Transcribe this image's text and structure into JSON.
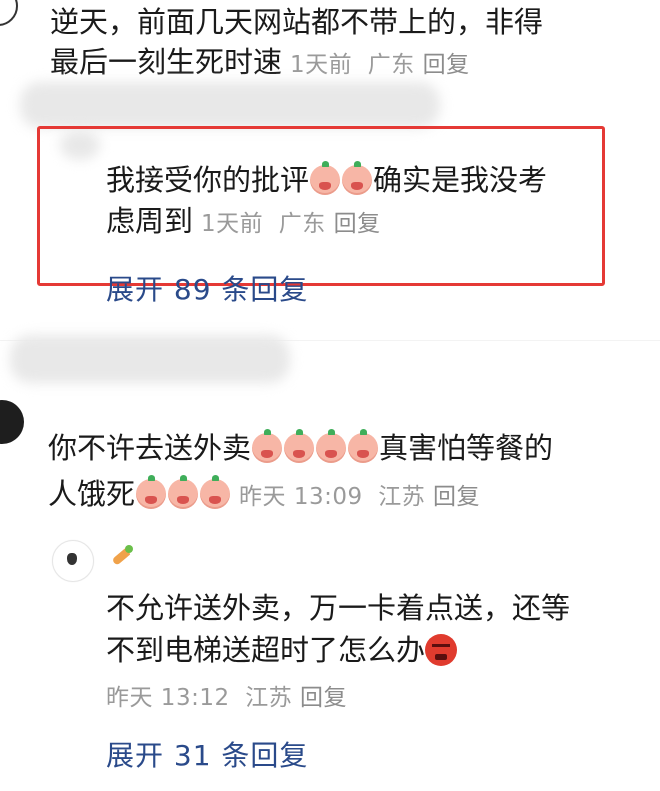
{
  "comment1": {
    "text_line1": "逆天，前面几天网站都不带上的，非得",
    "text_line2": "最后一刻生死时速",
    "time": "1天前",
    "location": "广东",
    "reply_label": "回复"
  },
  "reply1": {
    "text_line1_part1": "我接受你的批评",
    "emoji_face": "crying-face-emoji",
    "text_line1_part2": "确实是我没考",
    "text_line2": "虑周到",
    "time": "1天前",
    "location": "广东",
    "reply_label": "回复",
    "expand_label": "展开 89 条回复"
  },
  "comment2": {
    "text_line1_part1": "你不许去送外卖",
    "emoji_face": "crying-face-emoji",
    "text_line1_part2": "真害怕等餐的",
    "text_line2": "人饿死",
    "time": "昨天 13:09",
    "location": "江苏",
    "reply_label": "回复"
  },
  "reply2": {
    "username_icon": "carrot-icon",
    "text_line1": "不允许送外卖，万一卡着点送，还等",
    "text_line2": "不到电梯送超时了怎么办",
    "emoji_end": "angry-face-emoji",
    "time": "昨天 13:12",
    "location": "江苏",
    "reply_label": "回复",
    "expand_label": "展开 31 条回复"
  },
  "colors": {
    "highlight_border": "#e53935",
    "expand_link": "#2a4a8a",
    "meta_gray": "#9a9a9a"
  }
}
